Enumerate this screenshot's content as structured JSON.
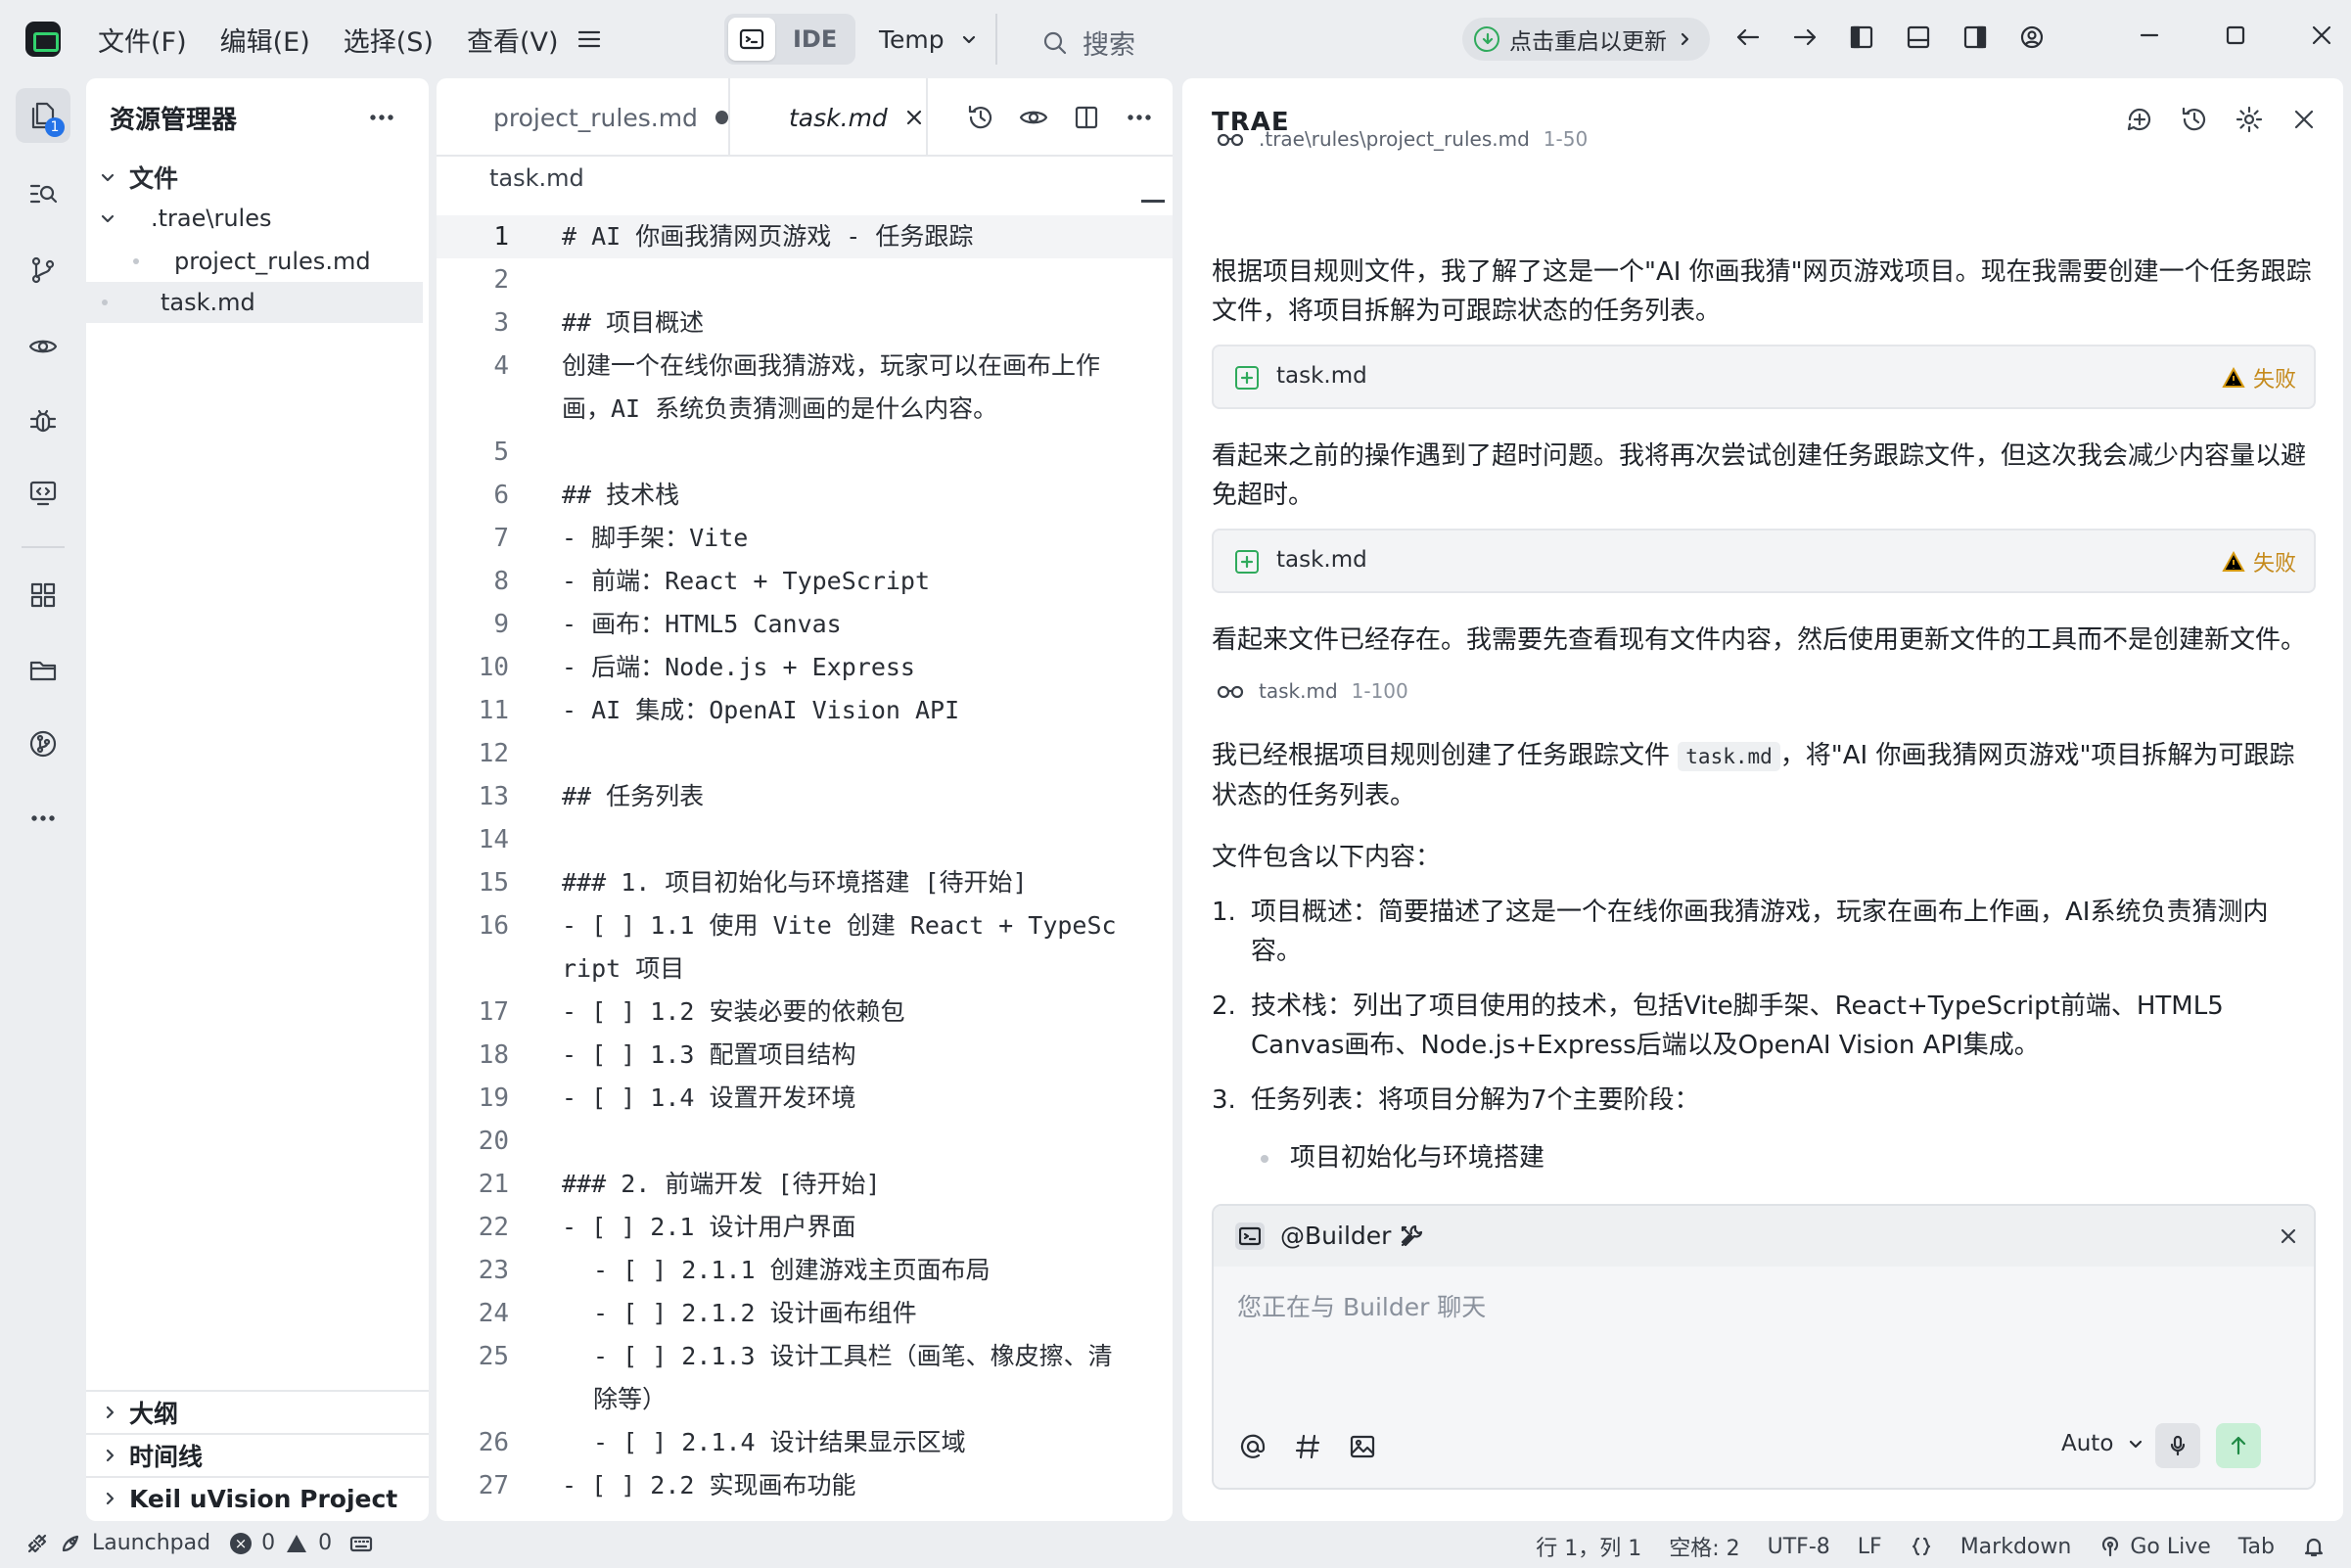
{
  "titlebar": {
    "menus": [
      "文件(F)",
      "编辑(E)",
      "选择(S)",
      "查看(V)"
    ],
    "mode_label": "IDE",
    "workspace": "Temp",
    "search_label": "搜索",
    "update_label": "点击重启以更新"
  },
  "activity": {
    "badge": "1"
  },
  "explorer": {
    "title": "资源管理器",
    "root_label": "文件",
    "folder_label": ".trae\\rules",
    "file1": "project_rules.md",
    "file2": "task.md",
    "outline": "大纲",
    "timeline": "时间线",
    "keil": "Keil uVision Project"
  },
  "editor": {
    "tab1": "project_rules.md",
    "tab2": "task.md",
    "breadcrumb": "task.md",
    "lines": [
      {
        "n": "1",
        "t": "# AI 你画我猜网页游戏 - 任务跟踪"
      },
      {
        "n": "2",
        "t": ""
      },
      {
        "n": "3",
        "t": "## 项目概述"
      },
      {
        "n": "4",
        "t": "创建一个在线你画我猜游戏，玩家可以在画布上作画，AI 系统负责猜测画的是什么内容。"
      },
      {
        "n": "5",
        "t": ""
      },
      {
        "n": "6",
        "t": "## 技术栈"
      },
      {
        "n": "7",
        "t": "- 脚手架：Vite"
      },
      {
        "n": "8",
        "t": "- 前端：React + TypeScript"
      },
      {
        "n": "9",
        "t": "- 画布：HTML5 Canvas"
      },
      {
        "n": "10",
        "t": "- 后端：Node.js + Express"
      },
      {
        "n": "11",
        "t": "- AI 集成：OpenAI Vision API"
      },
      {
        "n": "12",
        "t": ""
      },
      {
        "n": "13",
        "t": "## 任务列表"
      },
      {
        "n": "14",
        "t": ""
      },
      {
        "n": "15",
        "t": "### 1. 项目初始化与环境搭建 [待开始]"
      },
      {
        "n": "16",
        "t": "- [ ] 1.1 使用 Vite 创建 React + TypeScript 项目"
      },
      {
        "n": "17",
        "t": "- [ ] 1.2 安装必要的依赖包"
      },
      {
        "n": "18",
        "t": "- [ ] 1.3 配置项目结构"
      },
      {
        "n": "19",
        "t": "- [ ] 1.4 设置开发环境"
      },
      {
        "n": "20",
        "t": ""
      },
      {
        "n": "21",
        "t": "### 2. 前端开发 [待开始]"
      },
      {
        "n": "22",
        "t": "- [ ] 2.1 设计用户界面"
      },
      {
        "n": "23",
        "t": "- [ ] 2.1.1 创建游戏主页面布局"
      },
      {
        "n": "24",
        "t": "- [ ] 2.1.2 设计画布组件"
      },
      {
        "n": "25",
        "t": "- [ ] 2.1.3 设计工具栏（画笔、橡皮擦、清除等）"
      },
      {
        "n": "26",
        "t": "- [ ] 2.1.4 设计结果显示区域"
      },
      {
        "n": "27",
        "t": "- [ ] 2.2 实现画布功能"
      }
    ]
  },
  "chat": {
    "title": "TRAE",
    "ref1_path": ".trae\\rules\\project_rules.md",
    "ref1_range": "1-50",
    "p1": "根据项目规则文件，我了解了这是一个\"AI 你画我猜\"网页游戏项目。现在我需要创建一个任务跟踪文件，将项目拆解为可跟踪状态的任务列表。",
    "op1_name": "task.md",
    "op1_status": "失败",
    "p2": "看起来之前的操作遇到了超时问题。我将再次尝试创建任务跟踪文件，但这次我会减少内容量以避免超时。",
    "op2_name": "task.md",
    "op2_status": "失败",
    "p3": "看起来文件已经存在。我需要先查看现有文件内容，然后使用更新文件的工具而不是创建新文件。",
    "ref2_path": "task.md",
    "ref2_range": "1-100",
    "p4_pre": "我已经根据项目规则创建了任务跟踪文件",
    "p4_code": "task.md",
    "p4_post": "，将\"AI 你画我猜网页游戏\"项目拆解为可跟踪状态的任务列表。",
    "p5": "文件包含以下内容：",
    "list": [
      {
        "num": "1.",
        "text": "项目概述：简要描述了这是一个在线你画我猜游戏，玩家在画布上作画，AI系统负责猜测内容。"
      },
      {
        "num": "2.",
        "text": "技术栈：列出了项目使用的技术，包括Vite脚手架、React+TypeScript前端、HTML5 Canvas画布、Node.js+Express后端以及OpenAI Vision API集成。"
      },
      {
        "num": "3.",
        "text": "任务列表：将项目分解为7个主要阶段："
      }
    ],
    "sub_item": "项目初始化与环境搭建",
    "agent_name": "@Builder",
    "input_placeholder": "您正在与 Builder 聊天",
    "model": "Auto"
  },
  "statusbar": {
    "launchpad": "Launchpad",
    "errors": "0",
    "warnings": "0",
    "position": "行 1，列 1",
    "spaces": "空格: 2",
    "encoding": "UTF-8",
    "eol": "LF",
    "language": "Markdown",
    "golive": "Go Live",
    "tab": "Tab"
  }
}
